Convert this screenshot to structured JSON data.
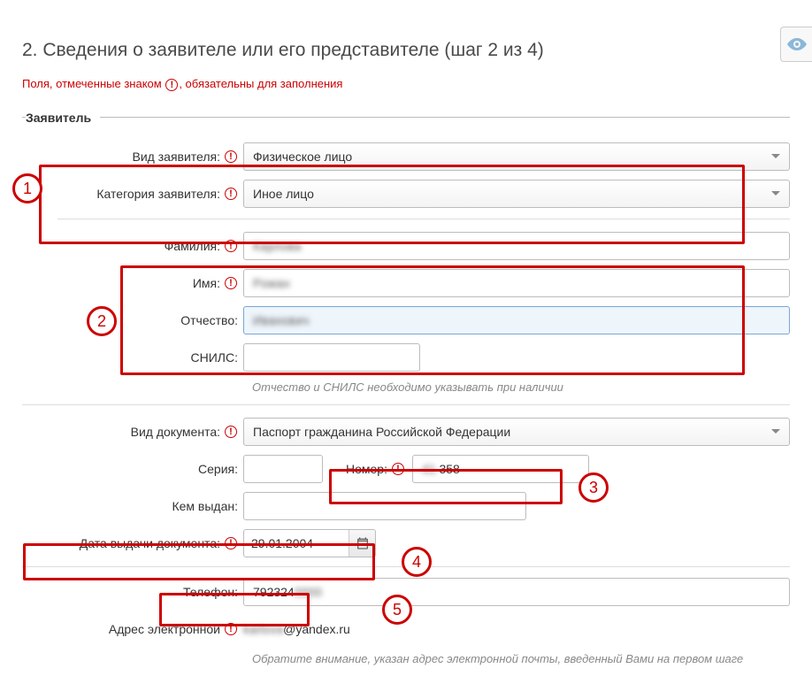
{
  "header": {
    "title": "2. Сведения о заявителе или его представителе (шаг 2 из 4)",
    "required_note_before": "Поля, отмеченные знаком",
    "required_note_after": ", обязательны для заполнения"
  },
  "group": {
    "legend": "Заявитель"
  },
  "labels": {
    "applicant_type": "Вид заявителя:",
    "applicant_category": "Категория заявителя:",
    "surname": "Фамилия:",
    "name": "Имя:",
    "patronymic": "Отчество:",
    "snils": "СНИЛС:",
    "document_type": "Вид документа:",
    "series": "Серия:",
    "number": "Номер:",
    "issued_by": "Кем выдан:",
    "issue_date": "Дата выдачи документа:",
    "phone": "Телефон:",
    "email": "Адрес электронной"
  },
  "values": {
    "applicant_type": "Физическое лицо",
    "applicant_category": "Иное лицо",
    "surname": "Карлова",
    "name": "Роман",
    "patronymic": "Иванович",
    "snils": "",
    "document_type": "Паспорт гражданина Российской Федерации",
    "series": "",
    "number_visible": "358",
    "number_hidden": "41 ",
    "issued_by": "",
    "issue_date": "29.01.2004",
    "phone_visible": "792324",
    "phone_hidden": "0000",
    "email_hidden": "karlova",
    "email_visible": "@yandex.ru"
  },
  "hints": {
    "snils": "Отчество и СНИЛС необходимо указывать при наличии",
    "email": "Обратите внимание, указан адрес электронной почты, введенный Вами на первом шаге"
  },
  "markers": {
    "m1": "1",
    "m2": "2",
    "m3": "3",
    "m4": "4",
    "m5": "5"
  }
}
